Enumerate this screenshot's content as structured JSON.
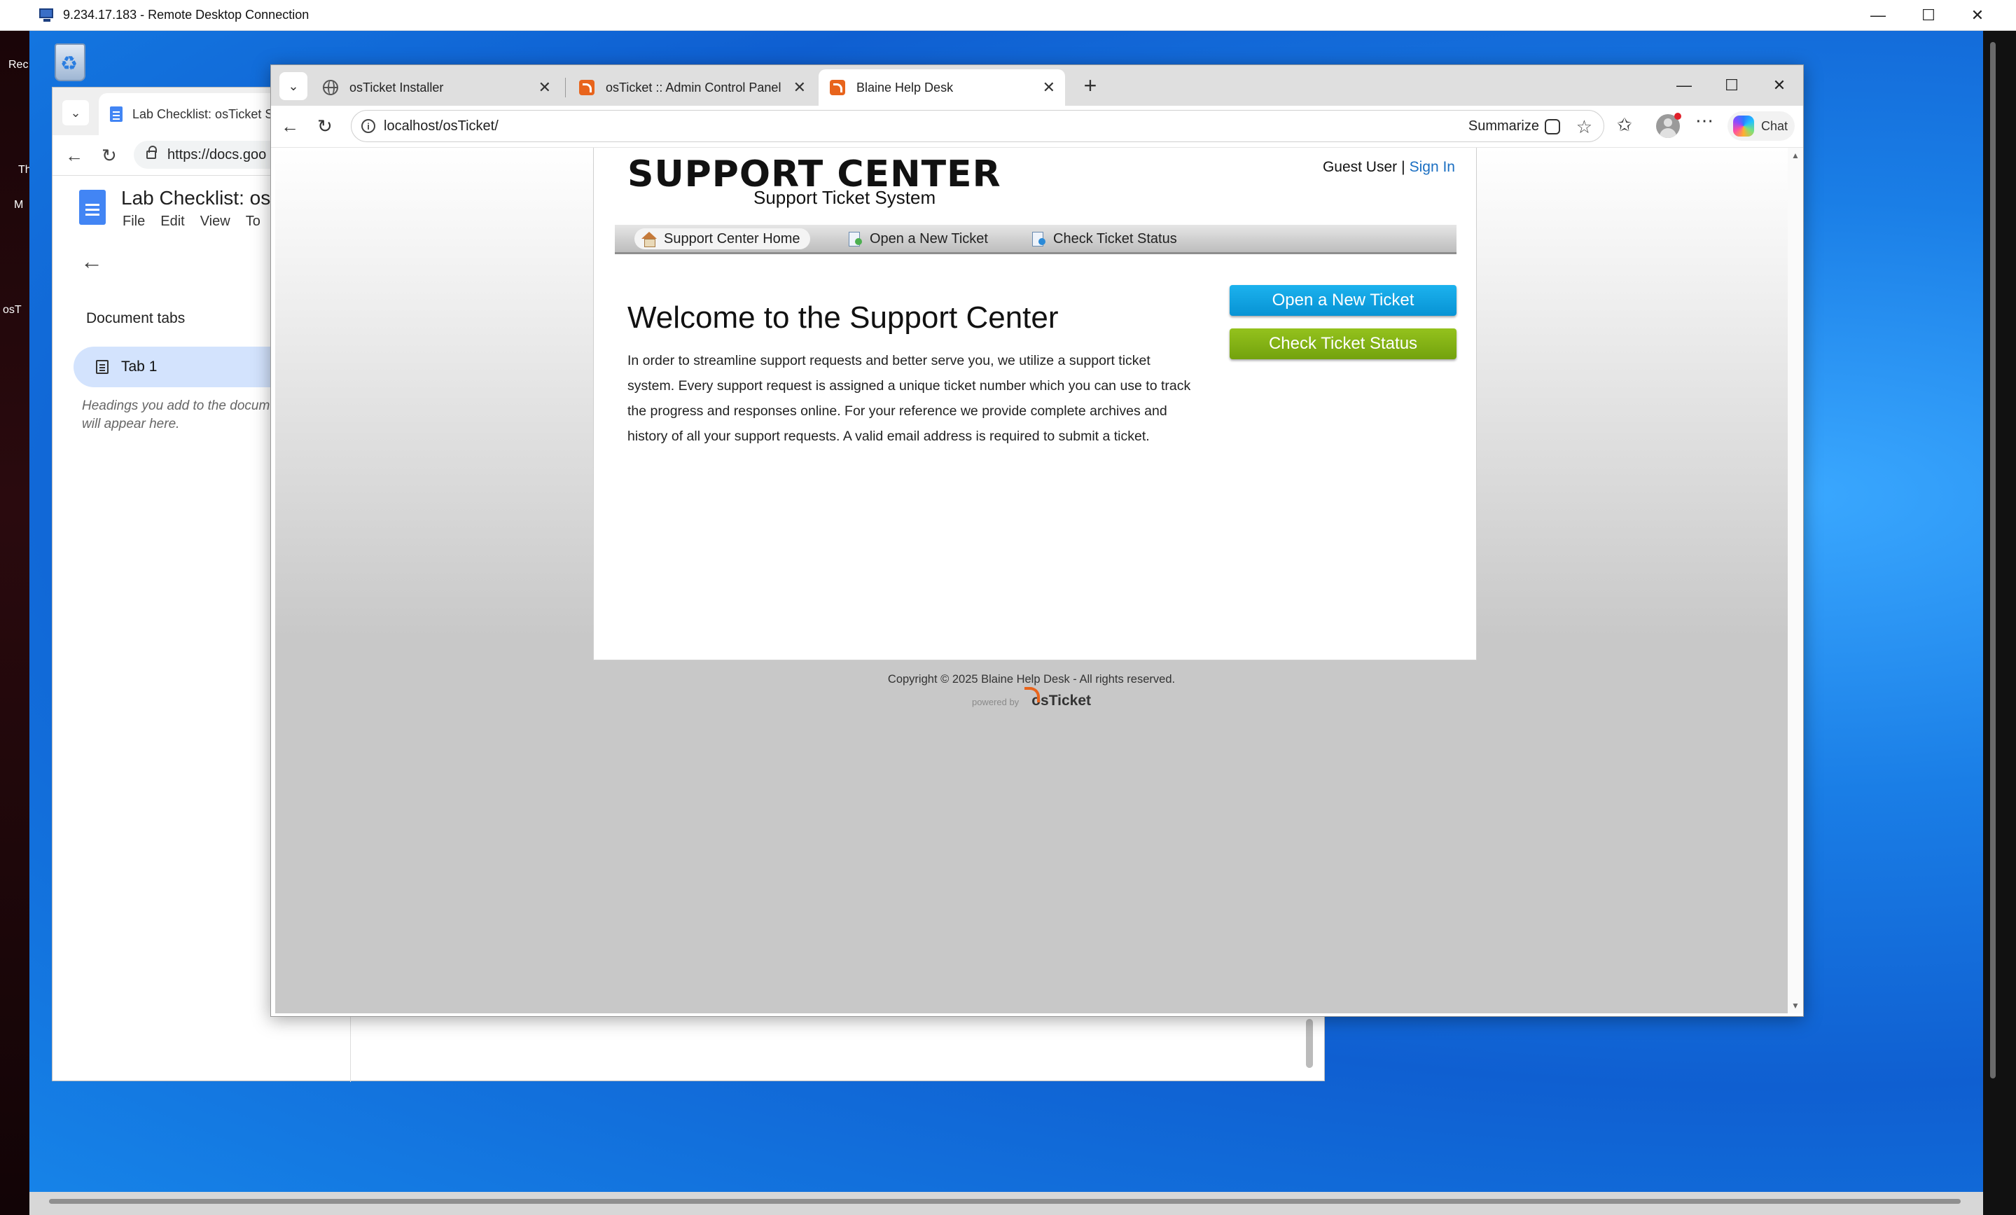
{
  "rdp": {
    "title": "9.234.17.183 - Remote Desktop Connection",
    "minimize": "—",
    "maximize": "☐",
    "close": "✕"
  },
  "desktop": {
    "icon_labels": [
      "Rec",
      "Th",
      "M",
      "osT"
    ]
  },
  "doc_window": {
    "tab_title": "Lab Checklist: osTicket Se",
    "url": "https://docs.goo",
    "doc_title": "Lab Checklist: osT",
    "menu": [
      "File",
      "Edit",
      "View",
      "To"
    ],
    "sidebar_heading": "Document tabs",
    "tab1_label": "Tab 1",
    "hint": "Headings you add to the docum\nwill appear here."
  },
  "browser": {
    "tabs": [
      {
        "label": "osTicket Installer",
        "icon": "globe-icon"
      },
      {
        "label": "osTicket :: Admin Control Panel",
        "icon": "osticket-icon"
      },
      {
        "label": "Blaine Help Desk",
        "icon": "osticket-icon",
        "active": true
      }
    ],
    "url": "localhost/osTicket/",
    "summarize_label": "Summarize",
    "chat_label": "Chat"
  },
  "page": {
    "logo_main": "SUPPORT CENTER",
    "logo_sub": "Support Ticket System",
    "guest_user": "Guest User",
    "separator": "|",
    "sign_in": "Sign In",
    "nav": [
      {
        "label": "Support Center Home",
        "icon": "home-icon",
        "active": true
      },
      {
        "label": "Open a New Ticket",
        "icon": "new-ticket-icon"
      },
      {
        "label": "Check Ticket Status",
        "icon": "ticket-status-icon"
      }
    ],
    "welcome_heading": "Welcome to the Support Center",
    "intro_text": "In order to streamline support requests and better serve you, we utilize a support ticket system. Every support request is assigned a unique ticket number which you can use to track the progress and responses online. For your reference we provide complete archives and history of all your support requests. A valid email address is required to submit a ticket.",
    "open_ticket_button": "Open a New Ticket",
    "check_status_button": "Check Ticket Status",
    "copyright": "Copyright © 2025 Blaine Help Desk - All rights reserved.",
    "powered_by": "powered by",
    "powered_logo": "osTicket"
  },
  "colors": {
    "open_button": "#0ea4e4",
    "status_button": "#84b416",
    "link": "#1b6fc2",
    "desktop": "#1a7ee6"
  }
}
